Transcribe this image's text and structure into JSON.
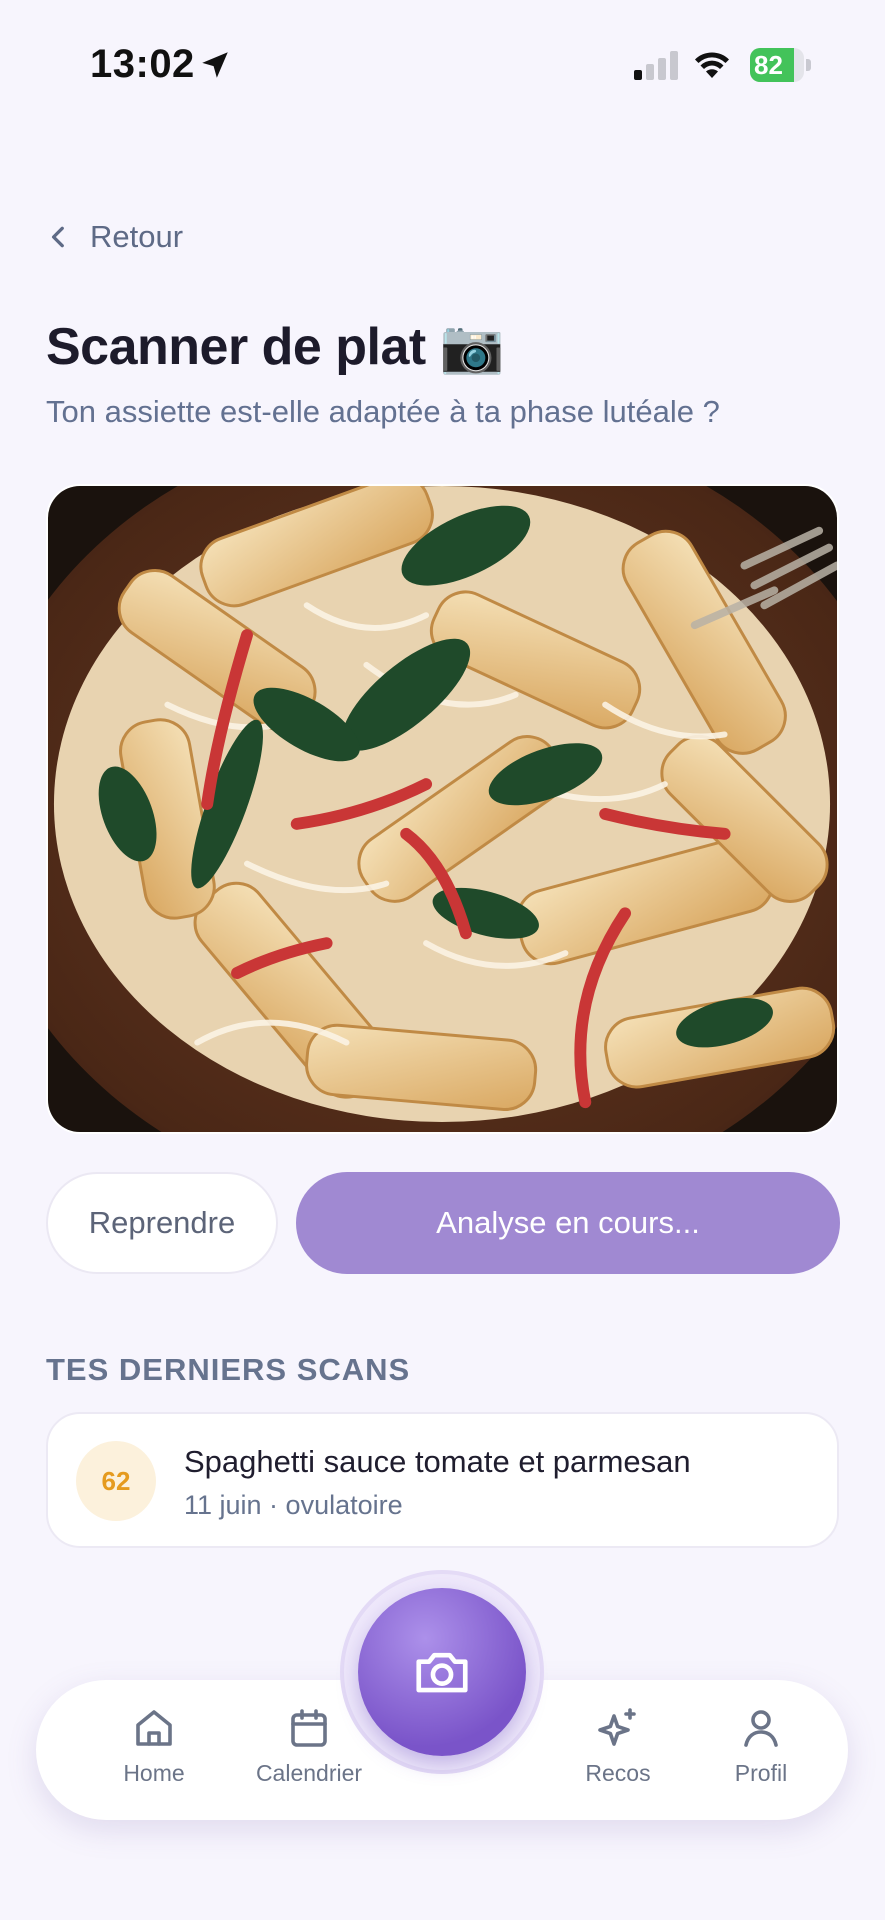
{
  "status_bar": {
    "time": "13:02",
    "battery": "82",
    "battery_level": 0.82,
    "battery_color": "#43c35a"
  },
  "header": {
    "back_label": "Retour",
    "title": "Scanner de plat 📷",
    "subtitle": "Ton assiette est-elle adaptée à ta phase lutéale ?"
  },
  "photo": {
    "icon": "dish-photo"
  },
  "actions": {
    "retake_label": "Reprendre",
    "analyze_label": "Analyse en cours..."
  },
  "recent_scans": {
    "title": "TES DERNIERS SCANS",
    "items": [
      {
        "score": "62",
        "name": "Spaghetti sauce tomate et parmesan",
        "meta": "11 juin · ovulatoire"
      }
    ]
  },
  "nav": {
    "items": [
      {
        "label": "Home",
        "icon": "home-icon"
      },
      {
        "label": "Calendrier",
        "icon": "calendar-icon"
      },
      {
        "label": "Recos",
        "icon": "sparkles-icon"
      },
      {
        "label": "Profil",
        "icon": "user-icon"
      }
    ],
    "center_icon": "camera-icon"
  },
  "colors": {
    "accent": "#a089d2",
    "fab": "#7a54c9",
    "score_bg": "#fcf1dc",
    "score_text": "#e59b1f",
    "background": "#f7f5fd"
  }
}
